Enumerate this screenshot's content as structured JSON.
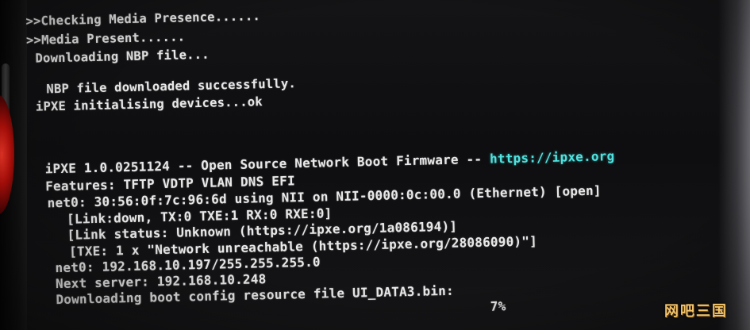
{
  "console": {
    "boot_lines": [
      ">>Checking Media Presence......",
      ">>Media Present......",
      "Downloading NBP file...",
      "NBP file downloaded successfully.",
      "iPXE initialising devices...ok"
    ],
    "ipxe_banner": {
      "prefix": "iPXE 1.0.0251124 -- Open Source Network Boot Firmware -- ",
      "url": "https://ipxe.org"
    },
    "features": "Features: TFTP VDTP VLAN DNS EFI",
    "net_lines": [
      "net0: 30:56:0f:7c:96:6d using NII on NII-0000:0c:00.0 (Ethernet) [open]",
      "[Link:down, TX:0 TXE:1 RX:0 RXE:0]",
      "[Link status: Unknown (https://ipxe.org/1a086194)]",
      "[TXE: 1 x \"Network unreachable (https://ipxe.org/28086090)\"]",
      "net0: 192.168.10.197/255.255.255.0",
      "Next server: 192.168.10.248",
      "Downloading boot config resource file UI_DATA3.bin:"
    ],
    "progress": "7%"
  },
  "colors": {
    "text": "#e8e8e8",
    "url": "#4fe3e0",
    "watermark": "#f3c46a",
    "indicator_light": "#ff3a2a"
  },
  "watermark": "网吧三国"
}
